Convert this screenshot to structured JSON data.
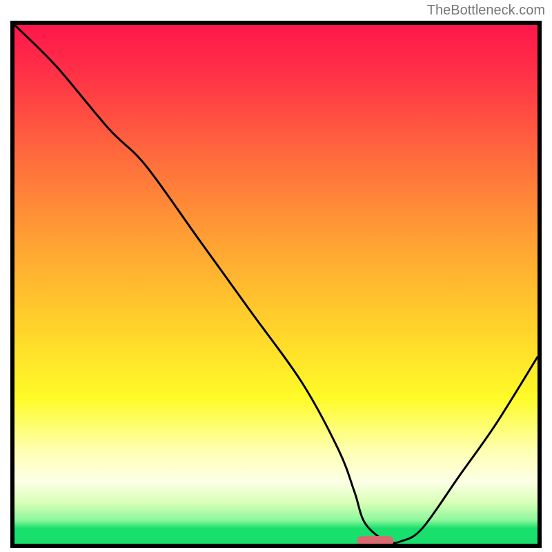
{
  "watermark": "TheBottleneck.com",
  "chart_data": {
    "type": "line",
    "title": "",
    "xlabel": "",
    "ylabel": "",
    "xlim": [
      0,
      100
    ],
    "ylim": [
      0,
      100
    ],
    "x": [
      0,
      8,
      18,
      25,
      35,
      45,
      55,
      62,
      65,
      67,
      71,
      74,
      78,
      85,
      92,
      100
    ],
    "values": [
      100,
      92,
      80,
      73,
      59,
      45,
      31,
      18,
      10,
      4,
      0.5,
      0.5,
      3,
      13,
      23,
      36
    ],
    "marker": {
      "x_center": 69,
      "y": 0.5,
      "width_pct": 7
    },
    "gradient_stops": [
      {
        "pct": 0,
        "color": "#ff164b"
      },
      {
        "pct": 10,
        "color": "#ff3346"
      },
      {
        "pct": 25,
        "color": "#ff6a3d"
      },
      {
        "pct": 42,
        "color": "#ffa233"
      },
      {
        "pct": 58,
        "color": "#ffd22a"
      },
      {
        "pct": 72,
        "color": "#fffb28"
      },
      {
        "pct": 82,
        "color": "#feffb0"
      },
      {
        "pct": 88,
        "color": "#fdffe6"
      },
      {
        "pct": 92,
        "color": "#d9ffb8"
      },
      {
        "pct": 95.5,
        "color": "#8cf79c"
      },
      {
        "pct": 97,
        "color": "#19e06c"
      },
      {
        "pct": 100,
        "color": "#19e06c"
      }
    ],
    "grid": false,
    "legend": null
  }
}
